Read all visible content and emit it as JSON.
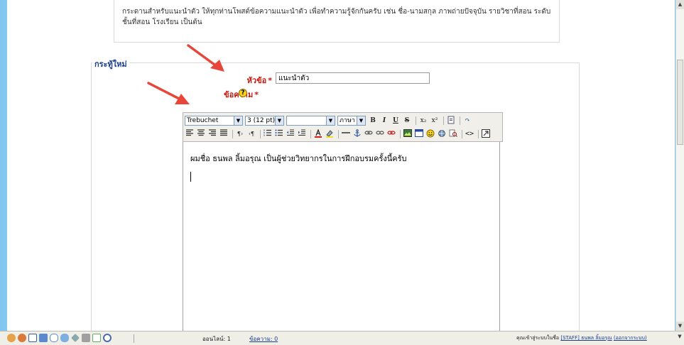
{
  "intro": {
    "text_line1": "กระดานสำหรับแนะนำตัว ให้ทุกท่านโพสต์ข้อความแนะนำตัว เพื่อทำความรู้จักกันครับ เช่น ชื่อ-นามสกุล ภาพถ่ายปัจจุบัน รายวิชาที่สอน ระดับ",
    "text_line2": "ชั้นที่สอน โรงเรียน เป็นต้น"
  },
  "form": {
    "legend": "กระทู้ใหม่",
    "subject_label": "หัวข้อ",
    "subject_value": "แนะนำตัว",
    "message_label": "ข้อความ",
    "required_marker": "*",
    "help_symbol": "?"
  },
  "toolbar": {
    "font_family": "Trebuchet",
    "font_size": "3 (12 pt)",
    "heading": "",
    "language": "ภาษา",
    "bold": "B",
    "italic": "I",
    "underline": "U",
    "strike": "S",
    "subscript": "x₂",
    "superscript": "x²",
    "undo": "↶",
    "redo": "↷"
  },
  "editor": {
    "content": "ผมชื่อ ธนพล ลิ้มอรุณ เป็นผู้ช่วยวิทยากรในการฝึกอบรมครั้งนี้ครับ"
  },
  "statusbar": {
    "online_text": "ออนไลน์: 1",
    "messages_text": "ข้อความ: 0",
    "login_prefix": "คุณเข้าสู่ระบบในชื่อ",
    "login_user": "[STAFF] ธนพล ลิ้มอรุณ",
    "logout_text": "(ออกจากระบบ)"
  },
  "colors": {
    "label_red": "#c2180d",
    "link_blue": "#1a3c8e",
    "arrow_red": "#e8463a"
  },
  "icons": [
    "question-help-icon",
    "arrow-annotation",
    "bold-icon",
    "italic-icon",
    "underline-icon",
    "strikethrough-icon",
    "subscript-icon",
    "superscript-icon",
    "justify-left-icon",
    "justify-center-icon",
    "justify-right-icon",
    "justify-full-icon",
    "ordered-list-icon",
    "unordered-list-icon",
    "outdent-icon",
    "indent-icon",
    "text-color-icon",
    "bg-color-icon",
    "horizontal-rule-icon",
    "anchor-icon",
    "link-icon",
    "unlink-icon",
    "nolink-icon",
    "image-icon",
    "table-icon",
    "smiley-icon",
    "special-char-icon",
    "search-replace-icon",
    "html-source-icon",
    "fullscreen-icon"
  ]
}
